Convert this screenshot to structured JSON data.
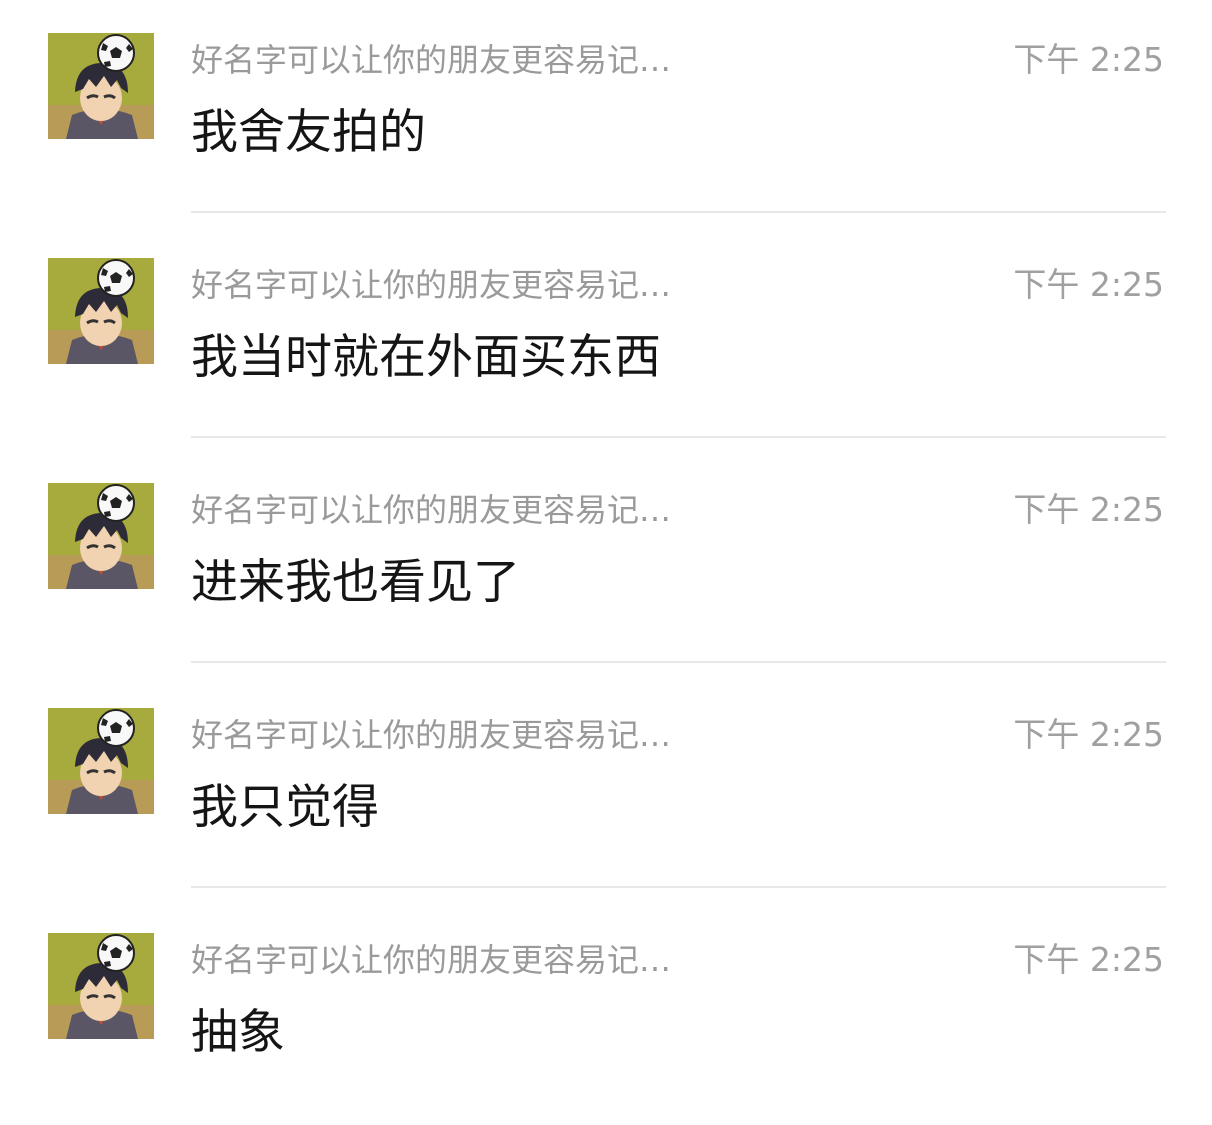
{
  "chat_list": {
    "items": [
      {
        "sender": "好名字可以让你的朋友更容易记…",
        "time": "下午 2:25",
        "message": "我舍友拍的",
        "avatar_icon": "anime-boy-soccer-ball-avatar"
      },
      {
        "sender": "好名字可以让你的朋友更容易记…",
        "time": "下午 2:25",
        "message": "我当时就在外面买东西",
        "avatar_icon": "anime-boy-soccer-ball-avatar"
      },
      {
        "sender": "好名字可以让你的朋友更容易记…",
        "time": "下午 2:25",
        "message": "进来我也看见了",
        "avatar_icon": "anime-boy-soccer-ball-avatar"
      },
      {
        "sender": "好名字可以让你的朋友更容易记…",
        "time": "下午 2:25",
        "message": "我只觉得",
        "avatar_icon": "anime-boy-soccer-ball-avatar"
      },
      {
        "sender": "好名字可以让你的朋友更容易记…",
        "time": "下午 2:25",
        "message": "抽象",
        "avatar_icon": "anime-boy-soccer-ball-avatar"
      }
    ]
  },
  "colors": {
    "background": "#ffffff",
    "sender_text": "#9a9a9a",
    "time_text": "#a0a0a0",
    "message_text": "#151515",
    "divider": "#e8e8e8"
  }
}
